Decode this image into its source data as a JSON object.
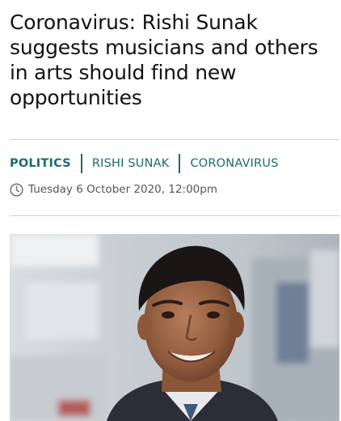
{
  "article": {
    "headline": "Coronavirus: Rishi Sunak suggests musicians and others in arts should find new opportunities",
    "tags": [
      "POLITICS",
      "RISHI SUNAK",
      "CORONAVIRUS"
    ],
    "dateline": "Tuesday 6 October 2020, 12:00pm"
  },
  "icons": {
    "dateline_icon": "clock-icon"
  },
  "colors": {
    "tag_accent": "#1a6b72",
    "headline": "#121212",
    "dateline": "#555555"
  }
}
